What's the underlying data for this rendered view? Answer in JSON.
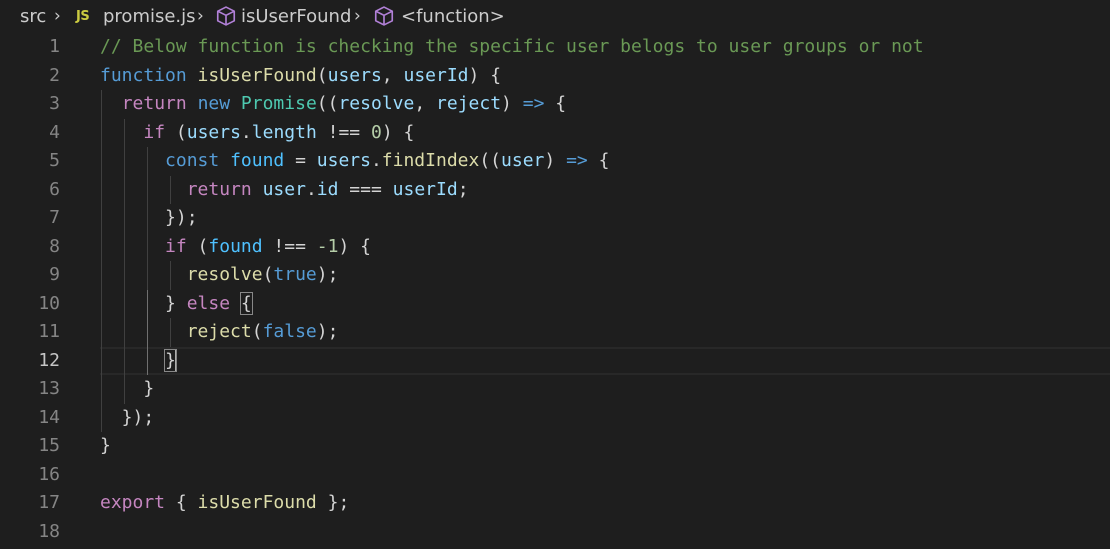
{
  "breadcrumb": {
    "folder": "src",
    "file_icon": "JS",
    "file": "promise.js",
    "symbol": "isUserFound",
    "function": "<function>"
  },
  "editor": {
    "active_line": 12,
    "lines": [
      {
        "n": "1",
        "tokens": [
          {
            "t": "// Below function is checking the specific user belogs to user groups or not",
            "c": "comment"
          }
        ]
      },
      {
        "n": "2",
        "tokens": [
          {
            "t": "function",
            "c": "kw"
          },
          {
            "t": " ",
            "c": "op"
          },
          {
            "t": "isUserFound",
            "c": "fn"
          },
          {
            "t": "(",
            "c": "op"
          },
          {
            "t": "users",
            "c": "var"
          },
          {
            "t": ", ",
            "c": "op"
          },
          {
            "t": "userId",
            "c": "var"
          },
          {
            "t": ") {",
            "c": "op"
          }
        ]
      },
      {
        "n": "3",
        "tokens": [
          {
            "t": "  ",
            "c": "op"
          },
          {
            "t": "return",
            "c": "ctrl"
          },
          {
            "t": " ",
            "c": "op"
          },
          {
            "t": "new",
            "c": "kw"
          },
          {
            "t": " ",
            "c": "op"
          },
          {
            "t": "Promise",
            "c": "type"
          },
          {
            "t": "((",
            "c": "op"
          },
          {
            "t": "resolve",
            "c": "var"
          },
          {
            "t": ", ",
            "c": "op"
          },
          {
            "t": "reject",
            "c": "var"
          },
          {
            "t": ") ",
            "c": "op"
          },
          {
            "t": "=>",
            "c": "kw"
          },
          {
            "t": " {",
            "c": "op"
          }
        ]
      },
      {
        "n": "4",
        "tokens": [
          {
            "t": "    ",
            "c": "op"
          },
          {
            "t": "if",
            "c": "ctrl"
          },
          {
            "t": " (",
            "c": "op"
          },
          {
            "t": "users",
            "c": "var"
          },
          {
            "t": ".",
            "c": "op"
          },
          {
            "t": "length",
            "c": "var"
          },
          {
            "t": " !== ",
            "c": "op"
          },
          {
            "t": "0",
            "c": "num"
          },
          {
            "t": ") {",
            "c": "op"
          }
        ]
      },
      {
        "n": "5",
        "tokens": [
          {
            "t": "      ",
            "c": "op"
          },
          {
            "t": "const",
            "c": "kw"
          },
          {
            "t": " ",
            "c": "op"
          },
          {
            "t": "found",
            "c": "const"
          },
          {
            "t": " = ",
            "c": "op"
          },
          {
            "t": "users",
            "c": "var"
          },
          {
            "t": ".",
            "c": "op"
          },
          {
            "t": "findIndex",
            "c": "fn"
          },
          {
            "t": "((",
            "c": "op"
          },
          {
            "t": "user",
            "c": "var"
          },
          {
            "t": ") ",
            "c": "op"
          },
          {
            "t": "=>",
            "c": "kw"
          },
          {
            "t": " {",
            "c": "op"
          }
        ]
      },
      {
        "n": "6",
        "tokens": [
          {
            "t": "        ",
            "c": "op"
          },
          {
            "t": "return",
            "c": "ctrl"
          },
          {
            "t": " ",
            "c": "op"
          },
          {
            "t": "user",
            "c": "var"
          },
          {
            "t": ".",
            "c": "op"
          },
          {
            "t": "id",
            "c": "var"
          },
          {
            "t": " === ",
            "c": "op"
          },
          {
            "t": "userId",
            "c": "var"
          },
          {
            "t": ";",
            "c": "op"
          }
        ]
      },
      {
        "n": "7",
        "tokens": [
          {
            "t": "      });",
            "c": "op"
          }
        ]
      },
      {
        "n": "8",
        "tokens": [
          {
            "t": "      ",
            "c": "op"
          },
          {
            "t": "if",
            "c": "ctrl"
          },
          {
            "t": " (",
            "c": "op"
          },
          {
            "t": "found",
            "c": "const"
          },
          {
            "t": " !== ",
            "c": "op"
          },
          {
            "t": "-1",
            "c": "num"
          },
          {
            "t": ") {",
            "c": "op"
          }
        ]
      },
      {
        "n": "9",
        "tokens": [
          {
            "t": "        ",
            "c": "op"
          },
          {
            "t": "resolve",
            "c": "fn"
          },
          {
            "t": "(",
            "c": "op"
          },
          {
            "t": "true",
            "c": "kw"
          },
          {
            "t": ");",
            "c": "op"
          }
        ]
      },
      {
        "n": "10",
        "tokens": [
          {
            "t": "      } ",
            "c": "op"
          },
          {
            "t": "else",
            "c": "ctrl"
          },
          {
            "t": " ",
            "c": "op"
          },
          {
            "t": "{",
            "c": "op",
            "m": "bm"
          }
        ]
      },
      {
        "n": "11",
        "tokens": [
          {
            "t": "        ",
            "c": "op"
          },
          {
            "t": "reject",
            "c": "fn"
          },
          {
            "t": "(",
            "c": "op"
          },
          {
            "t": "false",
            "c": "kw"
          },
          {
            "t": ");",
            "c": "op"
          }
        ]
      },
      {
        "n": "12",
        "tokens": [
          {
            "t": "      ",
            "c": "op"
          },
          {
            "t": "}",
            "c": "op",
            "m": "bm"
          },
          {
            "t": "",
            "c": "op",
            "m": "cursor"
          }
        ]
      },
      {
        "n": "13",
        "tokens": [
          {
            "t": "    }",
            "c": "op"
          }
        ]
      },
      {
        "n": "14",
        "tokens": [
          {
            "t": "  });",
            "c": "op"
          }
        ]
      },
      {
        "n": "15",
        "tokens": [
          {
            "t": "}",
            "c": "op"
          }
        ]
      },
      {
        "n": "16",
        "tokens": []
      },
      {
        "n": "17",
        "tokens": [
          {
            "t": "export",
            "c": "ctrl"
          },
          {
            "t": " { ",
            "c": "op"
          },
          {
            "t": "isUserFound",
            "c": "fn"
          },
          {
            "t": " };",
            "c": "op"
          }
        ]
      },
      {
        "n": "18",
        "tokens": []
      }
    ]
  }
}
